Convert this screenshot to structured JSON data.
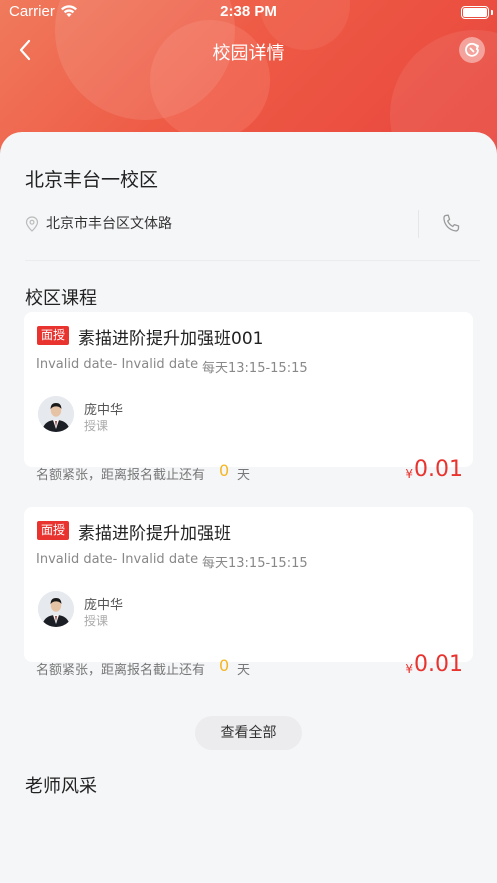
{
  "status_bar": {
    "carrier": "Carrier",
    "time": "2:38 PM"
  },
  "nav": {
    "title": "校园详情"
  },
  "campus": {
    "name": "北京丰台一校区",
    "address": "北京市丰台区文体路"
  },
  "sections": {
    "courses": "校区课程",
    "teachers": "老师风采"
  },
  "courses": [
    {
      "tag": "面授",
      "title": "素描进阶提升加强班001",
      "date": "Invalid date- Invalid date",
      "time": "每天13:15-15:15",
      "teacher": "庞中华",
      "role": "授课",
      "enroll_note": "名额紧张，距离报名截止还有",
      "enroll_count": "0",
      "enroll_unit": "天",
      "price_symbol": "¥",
      "price": "0.01"
    },
    {
      "tag": "面授",
      "title": "素描进阶提升加强班",
      "date": "Invalid date- Invalid date",
      "time": "每天13:15-15:15",
      "teacher": "庞中华",
      "role": "授课",
      "enroll_note": "名额紧张，距离报名截止还有",
      "enroll_count": "0",
      "enroll_unit": "天",
      "price_symbol": "¥",
      "price": "0.01"
    }
  ],
  "view_all_label": "查看全部",
  "icons": {
    "back": "chevron-left-icon",
    "refresh": "refresh-icon",
    "location": "location-pin-icon",
    "phone": "phone-icon"
  },
  "colors": {
    "accent": "#e8332e",
    "header_start": "#f07a5c",
    "header_end": "#e8453c",
    "count": "#f5b623"
  }
}
